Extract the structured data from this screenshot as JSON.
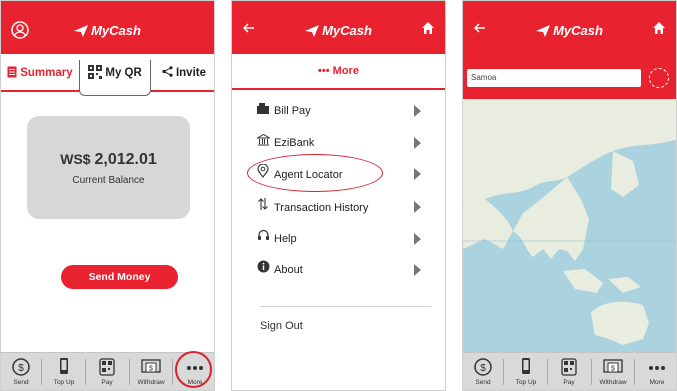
{
  "brand": {
    "name": "MyCash",
    "color": "#e8222e"
  },
  "panel1": {
    "tabs": {
      "summary": "Summary",
      "my_qr": "My QR",
      "invite": "Invite"
    },
    "balance": {
      "currency": "WS$",
      "amount": "2,012.01",
      "label": "Current Balance"
    },
    "send_money_label": "Send Money"
  },
  "panel2": {
    "more_tab_label": "••• More",
    "menu": [
      {
        "label": "Bill Pay",
        "icon": "bill-icon"
      },
      {
        "label": "EziBank",
        "icon": "bank-icon"
      },
      {
        "label": "Agent Locator",
        "icon": "location-pin-icon"
      },
      {
        "label": "Transaction History",
        "icon": "transaction-history-icon"
      },
      {
        "label": "Help",
        "icon": "headset-icon"
      },
      {
        "label": "About",
        "icon": "info-icon"
      }
    ],
    "sign_out_label": "Sign Out"
  },
  "panel3": {
    "search_value": "Samoa"
  },
  "bottom_nav": [
    {
      "label": "Send",
      "icon": "send-icon"
    },
    {
      "label": "Top Up",
      "icon": "phone-icon"
    },
    {
      "label": "Pay",
      "icon": "qr-icon"
    },
    {
      "label": "Withdraw",
      "icon": "cash-icon"
    },
    {
      "label": "More",
      "icon": "more-dots-icon"
    }
  ],
  "icons": {
    "hdr_left_p1": "user-circle-icon",
    "hdr_left_back": "back-arrow-icon",
    "hdr_right_home": "home-icon"
  }
}
